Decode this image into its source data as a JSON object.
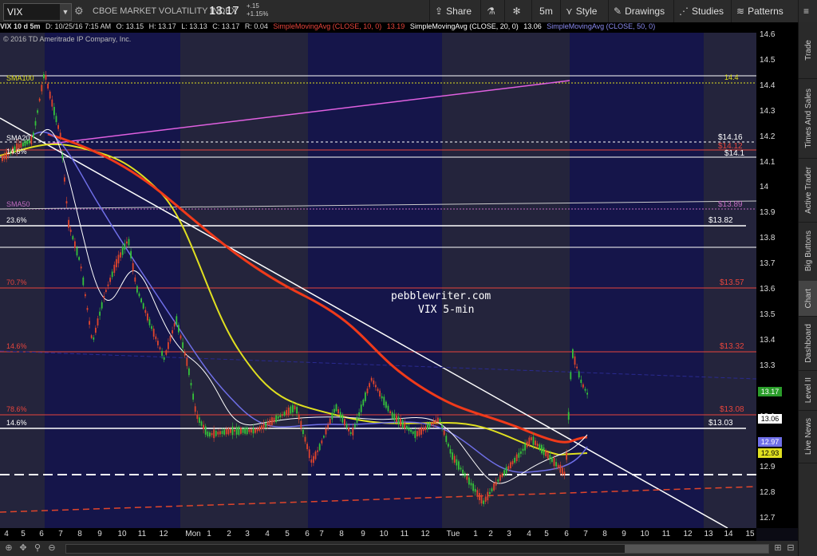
{
  "toolbar": {
    "symbol": "VIX",
    "description": "CBOE MARKET VOLATILITY INDEX",
    "last": "13.17",
    "change": "+.15",
    "change_pct": "+1.15%",
    "share": "Share",
    "timeframe": "5m",
    "style": "Style",
    "drawings": "Drawings",
    "studies": "Studies",
    "patterns": "Patterns"
  },
  "infobar": {
    "title": "VIX 10 d 5m",
    "date": "D: 10/25/16 7:15 AM",
    "open": "O: 13.15",
    "high": "H: 13.17",
    "low": "L: 13.13",
    "close": "C: 13.17",
    "range": "R: 0.04",
    "sma1_label": "SimpleMovingAvg (CLOSE, 10, 0)",
    "sma1_value": "13.19",
    "sma2_label": "SimpleMovingAvg (CLOSE, 20, 0)",
    "sma2_value": "13.06",
    "sma3_label": "SimpleMovingAvg (CLOSE, 50, 0)"
  },
  "copyright": "© 2016 TD Ameritrade IP Company, Inc.",
  "annotation": {
    "site": "pebblewriter.com",
    "subtitle": "VIX 5-min"
  },
  "levels": {
    "sma100": "SMA100",
    "v144": "14.4",
    "sma20": "SMA20",
    "v1416": "$14.16",
    "v1412": "$14.12",
    "v141": "$14.1",
    "l146a": "14.6%",
    "sma50": "SMA50",
    "v1389": "$13.89",
    "l236": "23.6%",
    "v1382": "$13.82",
    "l707": "70.7%",
    "v1357": "$13.57",
    "l146b": "14.6%",
    "v1332": "$13.32",
    "l786": "78.6%",
    "v1308": "$13.08",
    "l146c": "14.6%",
    "v1303": "$13.03"
  },
  "yaxis": {
    "ticks": [
      "14.6",
      "14.5",
      "14.4",
      "14.3",
      "14.2",
      "14.1",
      "14",
      "13.9",
      "13.8",
      "13.7",
      "13.6",
      "13.5",
      "13.4",
      "13.3",
      "13.2",
      "13.1",
      "13",
      "12.9",
      "12.8",
      "12.7"
    ],
    "badge_last": "13.17",
    "badge_sma20": "13.06",
    "badge_sma50": "12.97",
    "badge_sma100": "12.93"
  },
  "xaxis": {
    "ticks": [
      "4",
      "5",
      "6",
      "7",
      "8",
      "9",
      "10",
      "11",
      "12",
      "Mon",
      "1",
      "2",
      "3",
      "4",
      "5",
      "6",
      "7",
      "8",
      "9",
      "10",
      "11",
      "12",
      "Tue",
      "1",
      "2",
      "3",
      "4",
      "5",
      "6",
      "7",
      "8",
      "9",
      "10",
      "11",
      "12",
      "13",
      "14",
      "15"
    ]
  },
  "sidebar": [
    "Trade",
    "Times And Sales",
    "Active Trader",
    "Big Buttons",
    "Chart",
    "Dashboard",
    "Level II",
    "Live News"
  ],
  "colors": {
    "background": "#0b0b14",
    "session": "#15154a",
    "sma10": "#e8453c",
    "sma20": "#ffffff",
    "sma50": "#6f6fe8",
    "sma100": "#e0e020",
    "sma200": "#f03a1a",
    "up_candle": "#35c23a",
    "down_candle": "#e0452b"
  }
}
